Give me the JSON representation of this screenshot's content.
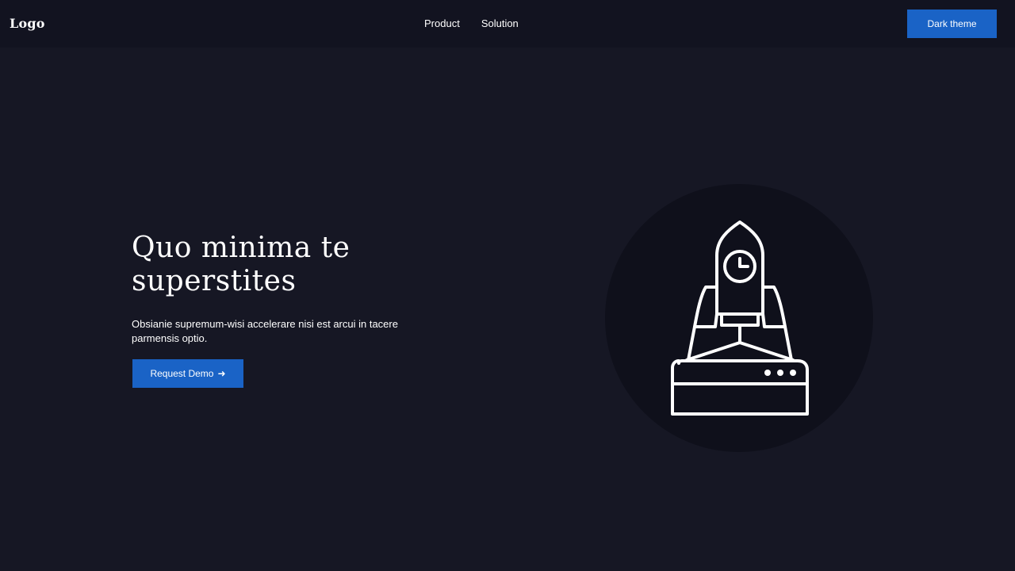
{
  "header": {
    "logo": "Logo",
    "nav": [
      {
        "label": "Product"
      },
      {
        "label": "Solution"
      }
    ],
    "theme_button": "Dark theme"
  },
  "hero": {
    "title": "Quo minima te superstites",
    "description": "Obsianie supremum-wisi accelerare nisi est arcui in tacere parmensis optio.",
    "cta_label": "Request Demo",
    "cta_icon": "arrow-right-icon"
  },
  "illustration": {
    "icon": "rocket-launch-icon"
  },
  "colors": {
    "background": "#161724",
    "header_background": "#121320",
    "accent": "#1a63c6",
    "illustration_circle": "#0f101b",
    "text": "#ffffff"
  }
}
